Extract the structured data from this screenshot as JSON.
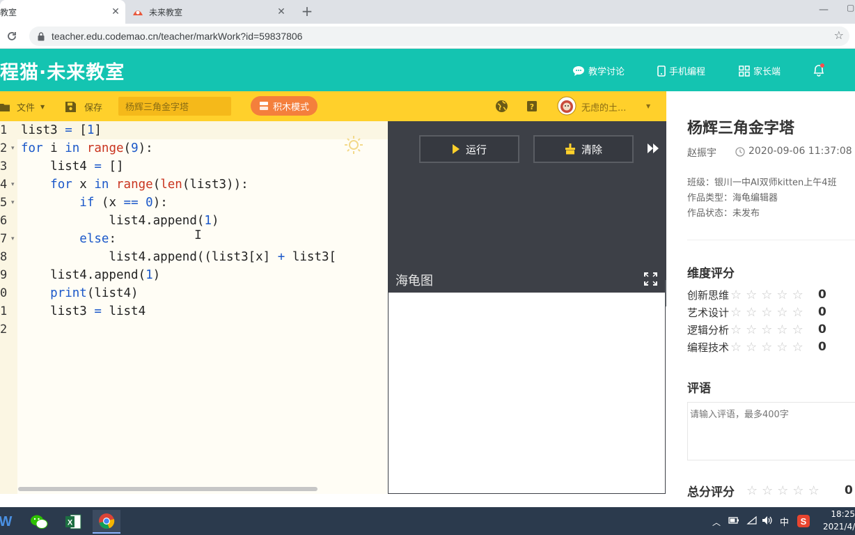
{
  "browser": {
    "tabs": [
      {
        "label": "教室",
        "active": true
      },
      {
        "label": "未来教室",
        "active": false
      }
    ],
    "url": "teacher.edu.codemao.cn/teacher/markWork?id=59837806"
  },
  "header": {
    "logo": "程猫·未来教室",
    "nav": [
      {
        "label": "教学讨论",
        "icon": "chat-icon"
      },
      {
        "label": "手机编程",
        "icon": "phone-icon"
      },
      {
        "label": "家长端",
        "icon": "grid-icon"
      }
    ]
  },
  "toolbar": {
    "file_label": "文件",
    "save_label": "保存",
    "work_title": "杨辉三角金字塔",
    "block_mode_label": "积木模式",
    "user_name": "无虑的土..."
  },
  "editor": {
    "line_numbers": [
      "1",
      "2",
      "3",
      "4",
      "5",
      "6",
      "7",
      "8",
      "9",
      "0",
      "1",
      "2"
    ],
    "lines": [
      "list3 = [1]",
      "for i in range(9):",
      "    list4 = []",
      "    for x in range(len(list3)):",
      "        if (x == 0):",
      "            list4.append(1)",
      "        else:",
      "            list4.append((list3[x] + list3[",
      "    list4.append(1)",
      "    print(list4)",
      "    list3 = list4",
      ""
    ]
  },
  "run_panel": {
    "run_label": "运行",
    "clear_label": "清除",
    "turtle_title": "海龟图"
  },
  "info": {
    "title": "杨辉三角金字塔",
    "author": "赵振宇",
    "time": "2020-09-06 11:37:08",
    "class_line": "班级：银川一中AI双师kitten上午4班",
    "type_line": "作品类型：海龟编辑器",
    "status_line": "作品状态：未发布",
    "rating_title": "维度评分",
    "ratings": [
      {
        "label": "创新思维",
        "score": "0"
      },
      {
        "label": "艺术设计",
        "score": "0"
      },
      {
        "label": "逻辑分析",
        "score": "0"
      },
      {
        "label": "编程技术",
        "score": "0"
      }
    ],
    "comment_title": "评语",
    "comment_placeholder": "请输入评语，最多400字",
    "total_title": "总分评分",
    "total_score": "0"
  },
  "taskbar": {
    "time": "18:25",
    "date": "2021/4/",
    "ime": "中"
  },
  "colors": {
    "header_bg": "#14c4b1",
    "toolbar_bg": "#ffd02b",
    "block_mode_bg": "#f47f3c",
    "dark_pane": "#3d4047"
  }
}
